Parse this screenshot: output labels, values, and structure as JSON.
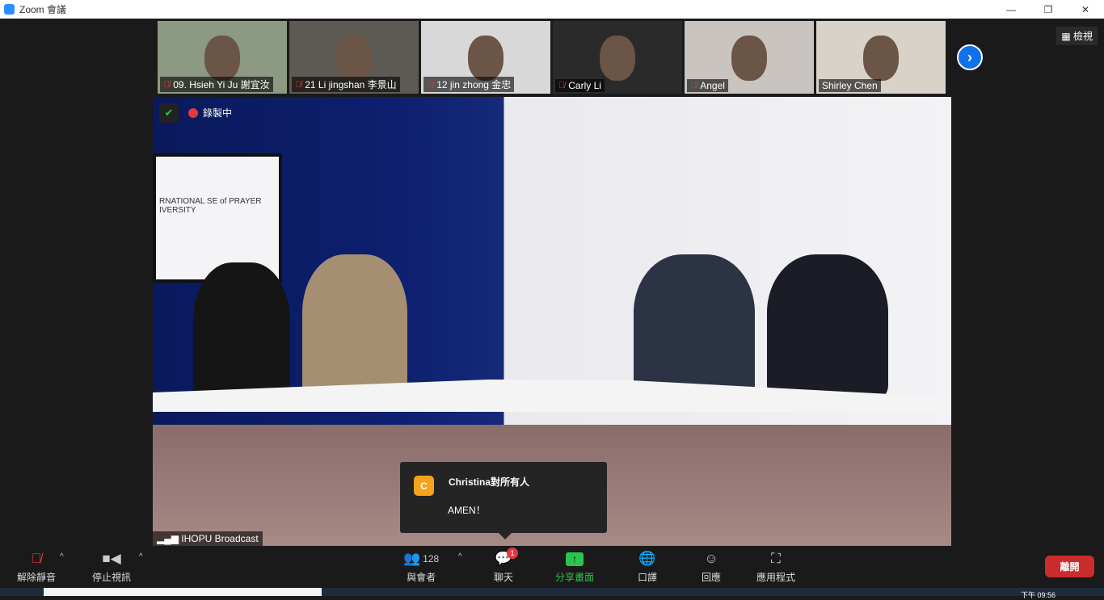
{
  "window": {
    "title": "Zoom 會議",
    "minimize": "—",
    "maximize": "❐",
    "close": "✕"
  },
  "thumbnails": [
    {
      "name": "09. Hsieh Yi Ju 謝宜汝",
      "muted": true,
      "bg": "#8d9a83"
    },
    {
      "name": "21 Li jingshan 李景山",
      "muted": true,
      "bg": "#5c5a52"
    },
    {
      "name": "12  jin  zhong   金忠",
      "muted": true,
      "bg": "#d8d8d8"
    },
    {
      "name": "Carly Li",
      "muted": true,
      "bg": "#2a2a2a"
    },
    {
      "name": "Angel",
      "muted": true,
      "bg": "#c9c4bf"
    },
    {
      "name": "Shirley Chen",
      "muted": false,
      "bg": "#d9d2c8"
    }
  ],
  "view_label": "檢視",
  "main_video": {
    "recording_label": "錄製中",
    "broadcast_label": "IHOPU Broadcast",
    "screen_text": "RNATIONAL SE of PRAYER IVERSITY"
  },
  "chat_popup": {
    "avatar": "C",
    "from": "Christina對所有人",
    "message": "AMEN！"
  },
  "toolbar": {
    "unmute": "解除靜音",
    "stop_video": "停止視訊",
    "participants": "與會者",
    "participants_count": "128",
    "chat": "聊天",
    "chat_badge": "1",
    "share": "分享畫面",
    "interpretation": "口譯",
    "reactions": "回應",
    "apps": "應用程式",
    "leave": "離開"
  },
  "taskbar": {
    "clock": "下午 09:56"
  },
  "colors": {
    "accent": "#0e72ed",
    "leave": "#c92d2d",
    "share": "#2ec24f",
    "muted": "#e0393e"
  }
}
